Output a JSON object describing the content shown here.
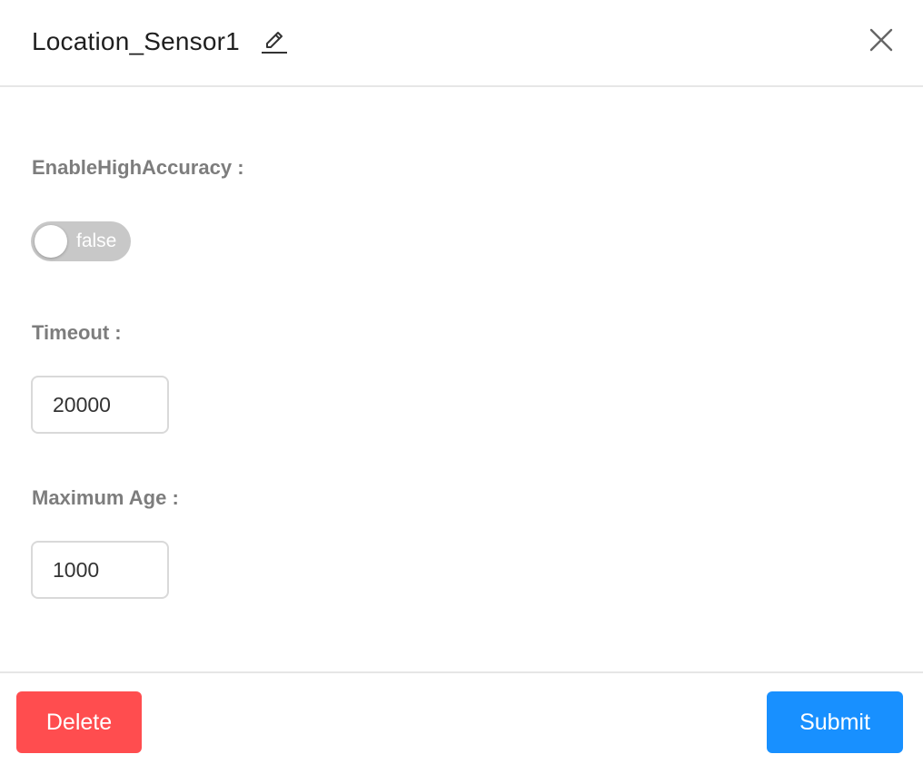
{
  "dialog": {
    "title": "Location_Sensor1"
  },
  "fields": {
    "high_accuracy": {
      "label": "EnableHighAccuracy :",
      "toggle_text": "false"
    },
    "timeout": {
      "label": "Timeout :",
      "value": "20000"
    },
    "maximum_age": {
      "label": "Maximum Age :",
      "value": "1000"
    }
  },
  "footer": {
    "delete_label": "Delete",
    "submit_label": "Submit"
  },
  "colors": {
    "delete": "#ff4d4f",
    "submit": "#1890ff",
    "toggle_off": "#c8c8c8",
    "label": "#7d7d7d"
  },
  "icons": {
    "edit": "pencil-icon",
    "close": "close-icon"
  }
}
